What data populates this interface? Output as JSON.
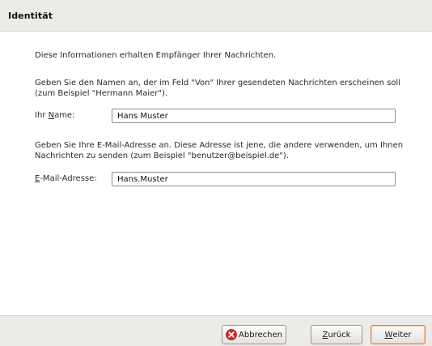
{
  "header": {
    "title": "Identität"
  },
  "main": {
    "intro": "Diese Informationen erhalten Empfänger Ihrer Nachrichten.",
    "name_help": "Geben Sie den Namen an, der im Feld \"Von\" Ihrer gesendeten Nachrichten erscheinen soll (zum Beispiel \"Hermann Maier\").",
    "name_label_pre": "Ihr ",
    "name_label_mn": "N",
    "name_label_post": "ame:",
    "name_value": "Hans Muster",
    "email_help": "Geben Sie Ihre E-Mail-Adresse an. Diese Adresse ist jene, die andere verwenden, um Ihnen Nachrichten zu senden (zum Beispiel \"benutzer@beispiel.de\").",
    "email_label_mn": "E",
    "email_label_post": "-Mail-Adresse:",
    "email_value": "Hans.Muster"
  },
  "buttons": {
    "cancel_label": "Abbrechen",
    "back_mn": "Z",
    "back_rest": "urück",
    "next_mn": "W",
    "next_rest": "eiter"
  },
  "icons": {
    "cancel": "cancel-x-icon"
  },
  "colors": {
    "header_bg": "#edebe8",
    "cancel_icon": "#d8272d",
    "default_button_border": "#d9864a"
  }
}
